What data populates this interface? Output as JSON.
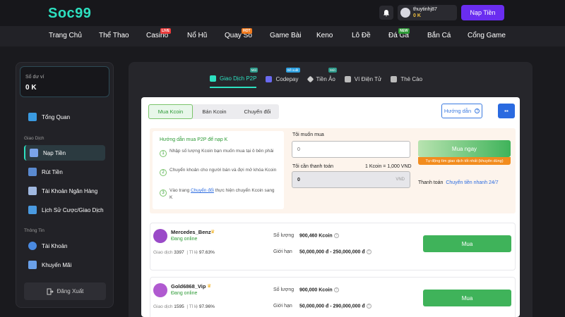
{
  "brand": {
    "logo": "Soc99"
  },
  "header": {
    "username": "thuytinhj87",
    "balance": "0 K",
    "deposit_label": "Nạp Tiền"
  },
  "nav": {
    "items": [
      {
        "label": "Trang Chủ",
        "badge": ""
      },
      {
        "label": "Thể Thao",
        "badge": ""
      },
      {
        "label": "Casino",
        "badge": "LIVE"
      },
      {
        "label": "Nổ Hũ",
        "badge": ""
      },
      {
        "label": "Quay Số",
        "badge": "HOT"
      },
      {
        "label": "Game Bài",
        "badge": ""
      },
      {
        "label": "Keno",
        "badge": ""
      },
      {
        "label": "Lô Đề",
        "badge": ""
      },
      {
        "label": "Đá Gà",
        "badge": "NEW"
      },
      {
        "label": "Bắn Cá",
        "badge": ""
      },
      {
        "label": "Cổng Game",
        "badge": ""
      }
    ]
  },
  "sidebar": {
    "balance_label": "Số dư ví",
    "balance_value": "0 K",
    "overview": "Tổng Quan",
    "section_transactions": "Giao Dịch",
    "items_transactions": [
      {
        "label": "Nạp Tiền",
        "icon": "deposit-icon",
        "active": true
      },
      {
        "label": "Rút Tiền",
        "icon": "withdraw-icon",
        "active": false
      },
      {
        "label": "Tài Khoản Ngân Hàng",
        "icon": "bank-icon",
        "active": false
      },
      {
        "label": "Lịch Sử Cược/Giao Dịch",
        "icon": "history-icon",
        "active": false
      }
    ],
    "section_info": "Thông Tin",
    "items_info": [
      {
        "label": "Tài Khoản",
        "icon": "user-icon"
      },
      {
        "label": "Khuyến Mãi",
        "icon": "gift-icon"
      }
    ],
    "logout": "Đăng Xuất"
  },
  "payment_tabs": [
    {
      "label": "Giao Dịch P2P",
      "badge": "Mới",
      "active": true
    },
    {
      "label": "Codepay",
      "badge": "Đề xuất",
      "active": false
    },
    {
      "label": "Tiền Ảo",
      "badge": "Mới",
      "active": false
    },
    {
      "label": "Ví Điện Tử",
      "badge": "",
      "active": false
    },
    {
      "label": "Thẻ Cào",
      "badge": "",
      "active": false
    }
  ],
  "p2p": {
    "segments": [
      "Mua Kcoin",
      "Bán Kcoin",
      "Chuyển đổi"
    ],
    "guide_button": "Hướng dẫn",
    "guide_title": "Hướng dẫn mua P2P để nạp K",
    "steps": [
      {
        "num": "1",
        "text": "Nhập số lượng Kcoin bạn muốn mua tại ô bên phải",
        "link": "",
        "after": ""
      },
      {
        "num": "2",
        "text": "Chuyển khoản cho người bán và đợi mở khóa Kcoin",
        "link": "",
        "after": ""
      },
      {
        "num": "3",
        "text": "Vào trang ",
        "link": "Chuyển đổi",
        "after": " thực hiện chuyển Kcoin sang K"
      }
    ],
    "want_label": "Tôi muốn mua",
    "want_placeholder": "0",
    "pay_label": "Tôi cần thanh toán",
    "rate": "1 Kcoin = 1,000 VND",
    "pay_value": "0",
    "pay_unit": "VND",
    "buy_now": "Mua ngay",
    "auto_note": "Tự động tìm giao dịch tốt nhất (khuyên dùng)",
    "payment_label": "Thanh toán",
    "payment_value": "Chuyển tiền nhanh 24/7"
  },
  "offers": [
    {
      "name": "Mercedes_Benz",
      "status": "Đang online",
      "trades_label": "Giao dịch",
      "trades": "3397",
      "rate_label": "Tỉ lệ",
      "rate": "97.63%",
      "qty_label": "Số lượng",
      "qty": "900,460 Kcoin",
      "limit_label": "Giới hạn",
      "limit": "50,000,000 đ - 250,000,000 đ",
      "buy": "Mua"
    },
    {
      "name": "Gold6868_Vip",
      "status": "Đang online",
      "trades_label": "Giao dịch",
      "trades": "1595",
      "rate_label": "Tỉ lệ",
      "rate": "97.96%",
      "qty_label": "Số lượng",
      "qty": "900,000 Kcoin",
      "limit_label": "Giới hạn",
      "limit": "50,000,000 đ - 290,000,000 đ",
      "buy": "Mua"
    }
  ],
  "colors": {
    "accent": "#2de0c0",
    "primary": "#6a2df0",
    "green": "#3fb35a",
    "blue": "#2a6ae0",
    "orange": "#f28c1e"
  }
}
